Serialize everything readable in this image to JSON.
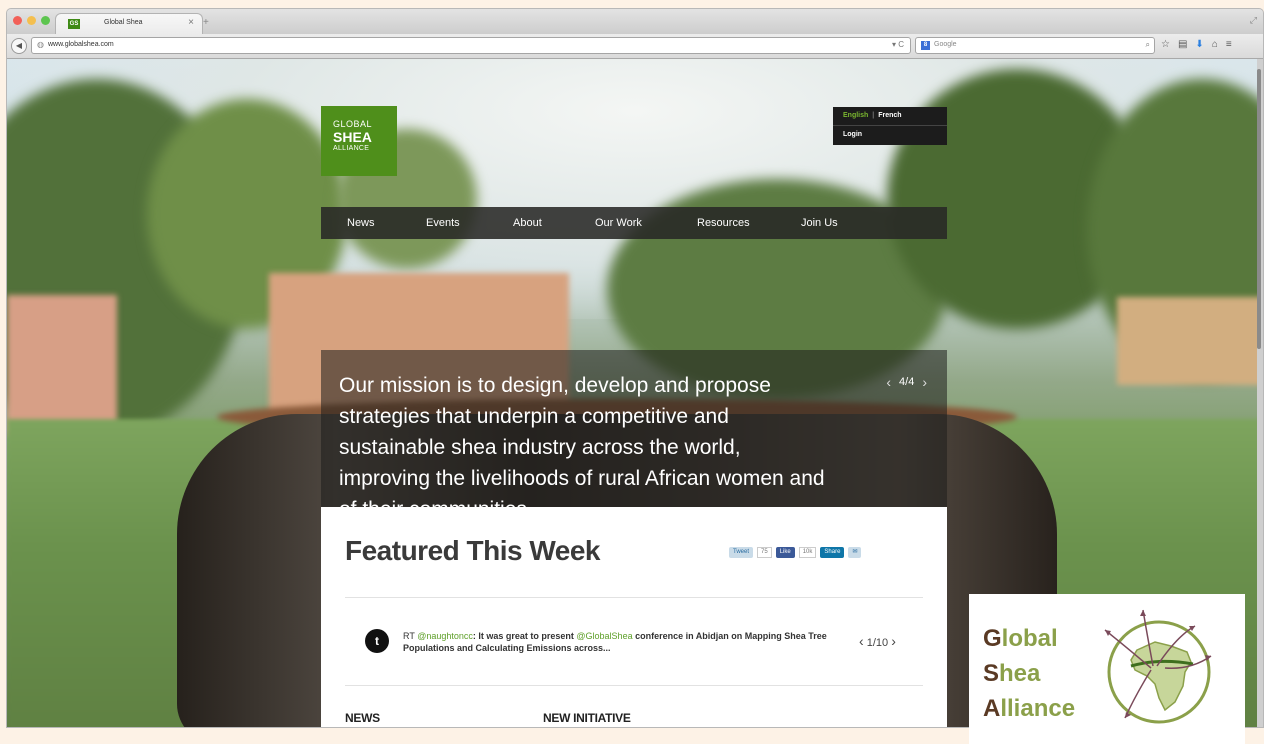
{
  "browser": {
    "tab_title": "Global Shea",
    "tab_close": "×",
    "new_tab": "+",
    "url": "www.globalshea.com",
    "search_placeholder": "Google",
    "search_engine_badge": "8"
  },
  "site": {
    "logo": {
      "line1": "GLOBAL",
      "line2": "SHEA",
      "line3": "ALLIANCE"
    },
    "lang": {
      "english": "English",
      "separator": "|",
      "french": "French",
      "login": "Login"
    },
    "nav": [
      "News",
      "Events",
      "About",
      "Our Work",
      "Resources",
      "Join Us"
    ],
    "mission": {
      "text": "Our mission is to design, develop and propose strategies that underpin a competitive and sustainable shea industry across the world, improving the livelihoods of rural African women and of their communities.",
      "counter": "4/4",
      "prev": "‹",
      "next": "›"
    },
    "featured": {
      "title": "Featured This Week",
      "share": {
        "tweet": "Tweet",
        "tweet_count": "75",
        "like": "Like",
        "like_count": "10k",
        "linkedin": "Share",
        "mail": "✉"
      }
    },
    "tweet": {
      "prefix": "RT ",
      "user": "@naughtoncc",
      "middle": ": It was great to present ",
      "mention": "@GlobalShea",
      "suffix": " conference in Abidjan on Mapping Shea Tree Populations and Calculating Emissions across...",
      "pager": "1/10",
      "prev": "‹",
      "next": "›"
    },
    "sections": {
      "news": "NEWS",
      "initiative": "NEW INITIATIVE"
    }
  },
  "overlay_logo": {
    "word1_cap": "G",
    "word1_rest": "lobal",
    "word2_cap": "S",
    "word2_rest": "hea",
    "word3_cap": "A",
    "word3_rest": "lliance"
  },
  "colors": {
    "brand_green": "#4f8f1b",
    "lang_active": "#7ab72f",
    "logo_brown": "#5a3a24",
    "logo_olive": "#8ba04a"
  }
}
